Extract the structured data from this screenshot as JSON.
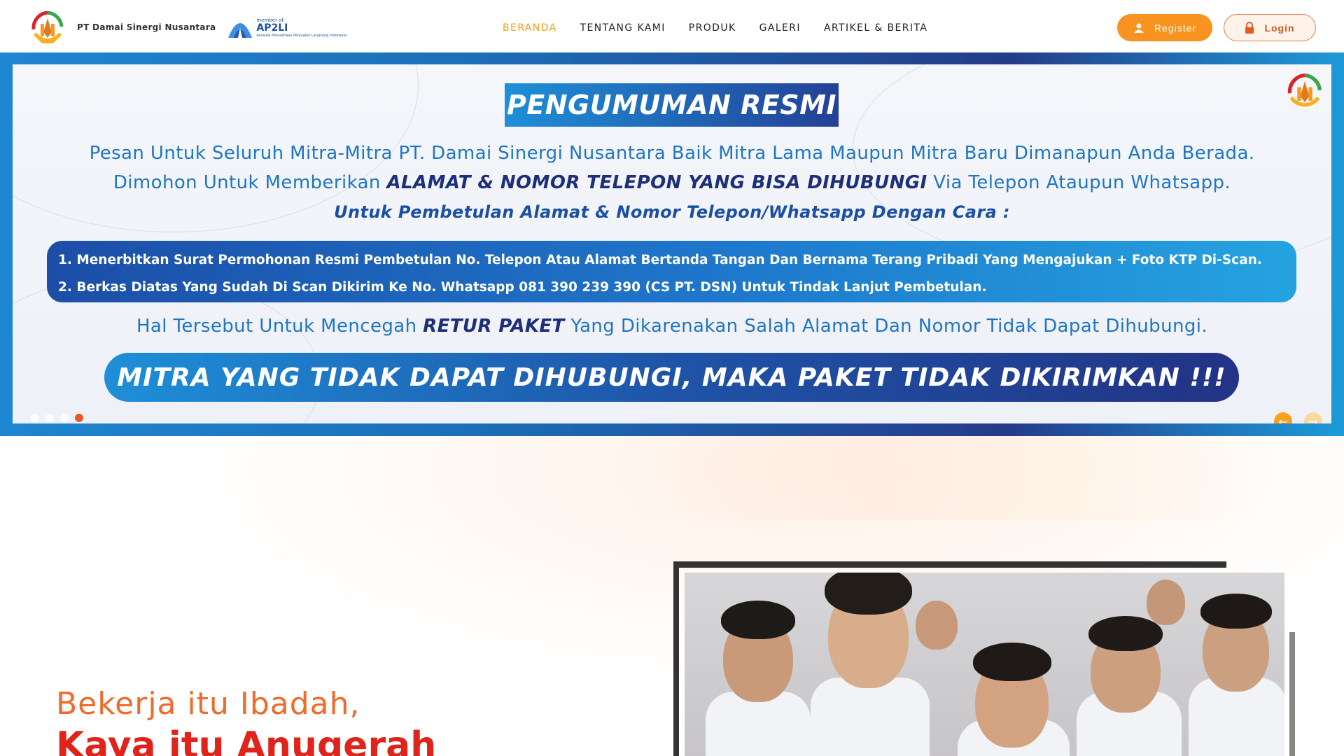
{
  "brand": {
    "company_name": "PT Damai Sinergi Nusantara",
    "member_small": "member of:",
    "member_name": "AP2LI",
    "member_sub": "Asosiasi Perusahaan Penjualan Langsung Indonesia"
  },
  "nav": {
    "items": [
      {
        "label": "BERANDA",
        "active": true
      },
      {
        "label": "TENTANG KAMI",
        "active": false
      },
      {
        "label": "PRODUK",
        "active": false
      },
      {
        "label": "GALERI",
        "active": false
      },
      {
        "label": "ARTIKEL & BERITA",
        "active": false
      }
    ],
    "register_label": "Register",
    "login_label": "Login"
  },
  "banner": {
    "title": "PENGUMUMAN RESMI",
    "line1": "Pesan Untuk Seluruh Mitra-Mitra PT. Damai Sinergi Nusantara Baik Mitra Lama Maupun Mitra Baru Dimanapun Anda Berada.",
    "line2_pre": "Dimohon Untuk Memberikan ",
    "line2_bold": "ALAMAT & NOMOR TELEPON YANG BISA DIHUBUNGI",
    "line2_post": " Via Telepon Ataupun Whatsapp.",
    "line3": "Untuk Pembetulan Alamat & Nomor Telepon/Whatsapp Dengan Cara :",
    "step1": "1. Menerbitkan Surat Permohonan Resmi Pembetulan No. Telepon Atau Alamat Bertanda Tangan Dan Bernama Terang Pribadi Yang Mengajukan + Foto KTP Di-Scan.",
    "step2": "2. Berkas Diatas Yang Sudah Di Scan Dikirim Ke No. Whatsapp 081 390 239 390 (CS PT. DSN) Untuk Tindak Lanjut Pembetulan.",
    "line4_pre": "Hal Tersebut Untuk Mencegah ",
    "line4_bold": "RETUR PAKET",
    "line4_post": " Yang Dikarenakan Salah Alamat Dan Nomor Tidak Dapat Dihubungi.",
    "warning": "MITRA YANG TIDAK DAPAT DIHUBUNGI, MAKA PAKET TIDAK DIKIRIMKAN !!!",
    "slide_count": 4,
    "active_slide": 4,
    "prev_arrow": "←",
    "next_arrow": "→"
  },
  "hero": {
    "tagline_1": "Bekerja itu Ibadah,",
    "tagline_2": "Kaya itu Anugerah"
  },
  "colors": {
    "accent_orange": "#f7931e",
    "nav_active": "#f0a017",
    "banner_blue": "#1f75c5",
    "banner_navy": "#1e2f7a",
    "tagline_red": "#e0241c"
  }
}
